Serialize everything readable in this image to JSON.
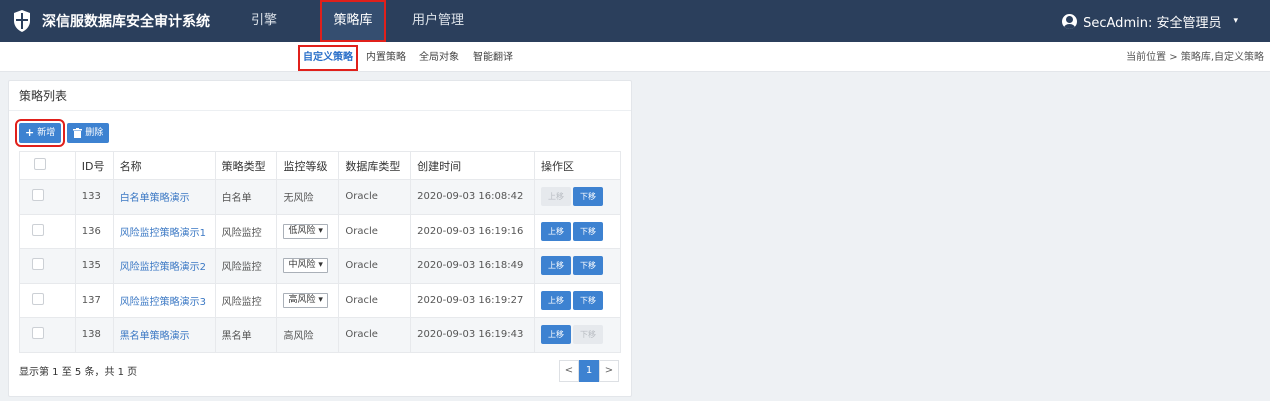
{
  "brand": {
    "title": "深信服数据库安全审计系统",
    "logo_icon": "shield-icon"
  },
  "nav": {
    "items": [
      {
        "label": "引擎"
      },
      {
        "label": "策略库"
      },
      {
        "label": "用户管理"
      }
    ],
    "active": "策略库"
  },
  "user": {
    "label": "SecAdmin: 安全管理员",
    "caret": "▾"
  },
  "subnav": {
    "tabs": [
      {
        "label": "自定义策略"
      },
      {
        "label": "内置策略"
      },
      {
        "label": "全局对象"
      },
      {
        "label": "智能翻译"
      }
    ],
    "breadcrumb": "当前位置 > 策略库,自定义策略"
  },
  "panel": {
    "title": "策略列表",
    "add_label": "新增",
    "delete_label": "删除"
  },
  "table": {
    "headers": [
      "ID号",
      "名称",
      "策略类型",
      "监控等级",
      "数据库类型",
      "创建时间",
      "操作区"
    ],
    "rows": [
      {
        "id": "133",
        "name": "白名单策略演示",
        "type": "白名单",
        "level": "无风险",
        "level_select": false,
        "db": "Oracle",
        "time": "2020-09-03 16:08:42",
        "up_enabled": false,
        "down_enabled": true
      },
      {
        "id": "136",
        "name": "风险监控策略演示1",
        "type": "风险监控",
        "level": "低风险",
        "level_select": true,
        "db": "Oracle",
        "time": "2020-09-03 16:19:16",
        "up_enabled": true,
        "down_enabled": true
      },
      {
        "id": "135",
        "name": "风险监控策略演示2",
        "type": "风险监控",
        "level": "中风险",
        "level_select": true,
        "db": "Oracle",
        "time": "2020-09-03 16:18:49",
        "up_enabled": true,
        "down_enabled": true
      },
      {
        "id": "137",
        "name": "风险监控策略演示3",
        "type": "风险监控",
        "level": "高风险",
        "level_select": true,
        "db": "Oracle",
        "time": "2020-09-03 16:19:27",
        "up_enabled": true,
        "down_enabled": true
      },
      {
        "id": "138",
        "name": "黑名单策略演示",
        "type": "黑名单",
        "level": "高风险",
        "level_select": false,
        "db": "Oracle",
        "time": "2020-09-03 16:19:43",
        "up_enabled": true,
        "down_enabled": false
      }
    ],
    "up_label": "上移",
    "down_label": "下移"
  },
  "footer": {
    "info": "显示第 1 至 5 条，共 1 页",
    "prev": "<",
    "current_page": "1",
    "next": ">"
  },
  "colors": {
    "navbar": "#2b3f5c",
    "accent": "#3d82d1",
    "highlight_border": "#e0201b"
  }
}
